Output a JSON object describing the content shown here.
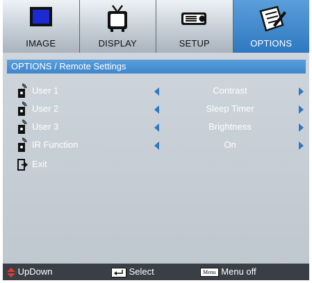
{
  "tabs": [
    {
      "label": "IMAGE",
      "icon": "monitor-icon",
      "active": false
    },
    {
      "label": "DISPLAY",
      "icon": "tv-icon",
      "active": false
    },
    {
      "label": "SETUP",
      "icon": "projector-icon",
      "active": false
    },
    {
      "label": "OPTIONS",
      "icon": "notepad-icon",
      "active": true
    }
  ],
  "panel": {
    "title": "OPTIONS / Remote Settings",
    "rows": [
      {
        "label": "User 1",
        "value": "Contrast",
        "icon": "remote-icon"
      },
      {
        "label": "User 2",
        "value": "Sleep Timer",
        "icon": "remote-icon"
      },
      {
        "label": "User 3",
        "value": "Brightness",
        "icon": "remote-icon"
      },
      {
        "label": "IR Function",
        "value": "On",
        "icon": "remote-icon"
      },
      {
        "label": "Exit",
        "icon": "exit-icon"
      }
    ]
  },
  "footer": {
    "updown_label": "UpDown",
    "select_label": "Select",
    "menu_key": "Menu",
    "menuoff_label": "Menu off"
  },
  "colors": {
    "accent": "#2f78c0",
    "panel": "#c6cdd4",
    "footer": "#3a3f47"
  }
}
